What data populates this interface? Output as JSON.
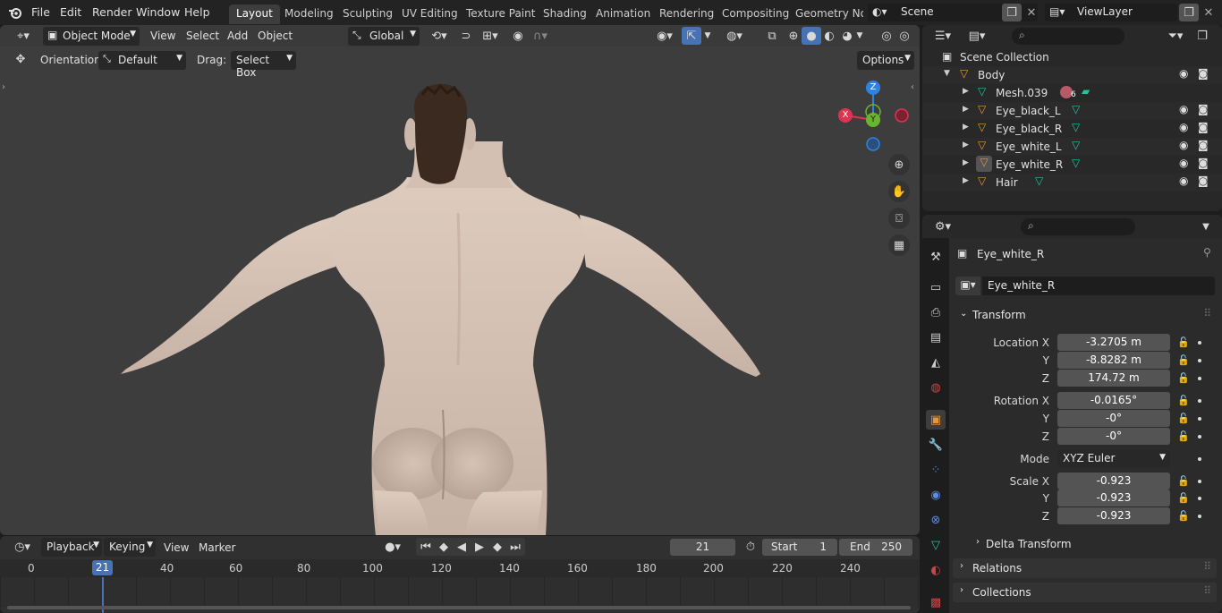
{
  "topbar": {
    "menus": [
      "File",
      "Edit",
      "Render",
      "Window",
      "Help"
    ],
    "workspaces": [
      "Layout",
      "Modeling",
      "Sculpting",
      "UV Editing",
      "Texture Paint",
      "Shading",
      "Animation",
      "Rendering",
      "Compositing",
      "Geometry Noc"
    ],
    "scene": "Scene",
    "view_layer": "ViewLayer"
  },
  "viewport": {
    "mode": "Object Mode",
    "menus": [
      "View",
      "Select",
      "Add",
      "Object"
    ],
    "transform_orientation": "Global",
    "orientation_label": "Orientation:",
    "orientation_value": "Default",
    "drag_label": "Drag:",
    "drag_value": "Select Box",
    "options_label": "Options",
    "gizmo": {
      "z": "Z",
      "y": "Y",
      "x": "X"
    }
  },
  "timeline": {
    "menus": [
      "Playback",
      "Keying",
      "View",
      "Marker"
    ],
    "current_frame": "21",
    "start_label": "Start",
    "start_value": "1",
    "end_label": "End",
    "end_value": "250",
    "ruler": [
      "0",
      "21",
      "40",
      "60",
      "80",
      "100",
      "120",
      "140",
      "160",
      "180",
      "200",
      "220",
      "240"
    ]
  },
  "outliner": {
    "root": "Scene Collection",
    "items": [
      {
        "name": "Body"
      },
      {
        "name": "Mesh.039",
        "badge": "6"
      },
      {
        "name": "Eye_black_L"
      },
      {
        "name": "Eye_black_R"
      },
      {
        "name": "Eye_white_L"
      },
      {
        "name": "Eye_white_R"
      },
      {
        "name": "Hair"
      }
    ]
  },
  "properties": {
    "object_name": "Eye_white_R",
    "datablock_name": "Eye_white_R",
    "transform": {
      "header": "Transform",
      "location_label": "Location X",
      "location": [
        "-3.2705 m",
        "-8.8282 m",
        "174.72 m"
      ],
      "rotation_label": "Rotation X",
      "rotation": [
        "-0.0165°",
        "-0°",
        "-0°"
      ],
      "mode_label": "Mode",
      "mode_value": "XYZ Euler",
      "scale_label": "Scale X",
      "scale": [
        "-0.923",
        "-0.923",
        "-0.923"
      ],
      "y_label": "Y",
      "z_label": "Z"
    },
    "panels": [
      "Delta Transform",
      "Relations",
      "Collections"
    ]
  },
  "colors": {
    "accent": "#4772b3",
    "object_orange": "#e8963a",
    "mesh_green": "#22c39e",
    "skin": "#d6c3b6",
    "hair": "#3a2a1f"
  }
}
